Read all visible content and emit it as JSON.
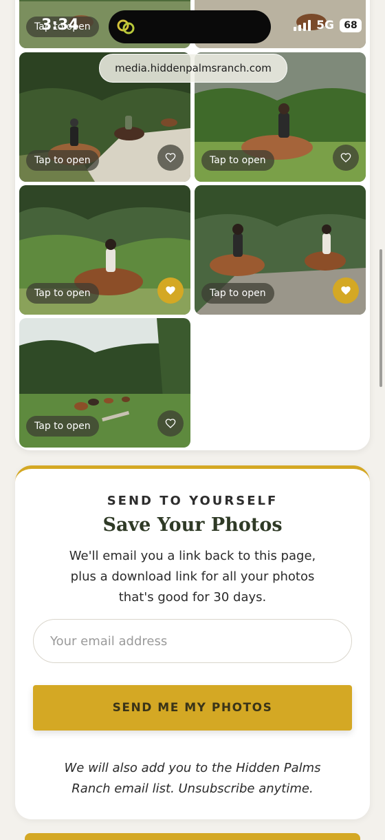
{
  "status_bar": {
    "time": "3:34",
    "network": "5G",
    "battery": "68"
  },
  "browser": {
    "url": "media.hiddenpalmsranch.com"
  },
  "gallery": {
    "photos": [
      {
        "tap_label": "Tap to open",
        "favorited": false
      },
      {
        "tap_label": "Tap to open",
        "favorited": false
      },
      {
        "tap_label": "Tap to open",
        "favorited": false
      },
      {
        "tap_label": "Tap to open",
        "favorited": false
      },
      {
        "tap_label": "Tap to open",
        "favorited": true
      },
      {
        "tap_label": "Tap to open",
        "favorited": true
      },
      {
        "tap_label": "Tap to open",
        "favorited": false
      }
    ]
  },
  "send_section": {
    "eyebrow": "SEND TO YOURSELF",
    "title": "Save Your Photos",
    "description": "We'll email you a link back to this page, plus a download link for all your photos that's good for 30 days.",
    "email_placeholder": "Your email address",
    "button_label": "SEND ME MY PHOTOS",
    "fine_print": "We will also add you to the Hidden Palms Ranch email list. Unsubscribe anytime."
  },
  "colors": {
    "accent": "#d4a824",
    "page_background": "#f3f1ec",
    "title_green": "#2f3a26"
  },
  "icons": {
    "favorite": "heart-icon",
    "app": "link-icon"
  }
}
